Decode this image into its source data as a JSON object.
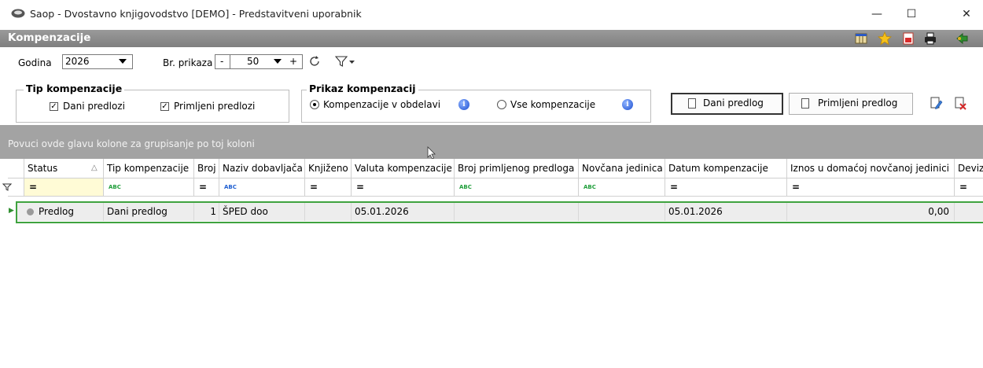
{
  "window": {
    "title": "Saop - Dvostavno knjigovodstvo [DEMO] - Predstavitveni uporabnik",
    "minimize": "—",
    "maximize": "☐",
    "close": "✕"
  },
  "header": {
    "title": "Kompenzacije"
  },
  "toolbar": {
    "year_label": "Godina",
    "year_value": "2026",
    "count_label": "Br. prikaza",
    "count_minus": "-",
    "count_value": "50",
    "count_plus": "+"
  },
  "tip_group": {
    "title": "Tip kompenzacije",
    "given_label": "Dani predlozi",
    "received_label": "Primljeni predlozi"
  },
  "prikaz_group": {
    "title": "Prikaz kompenzacij",
    "option_1": "Kompenzacije v obdelavi",
    "option_2": "Vse kompenzacije"
  },
  "buttons": {
    "dani": "Dani predlog",
    "primljeni": "Primljeni predlog"
  },
  "group_panel_text": "Povuci ovde glavu kolone za grupisanje po toj koloni",
  "columns": [
    "Status",
    "Tip kompenzacije",
    "Broj",
    "Naziv dobavljača",
    "Knjiženo",
    "Valuta kompenzacije",
    "Broj primljenog predloga",
    "Novčana jedinica",
    "Datum kompenzacije",
    "Iznos u domaćoj novčanoj jedinici",
    "Deviz"
  ],
  "filter": {
    "eq": "=",
    "abc": "ABC"
  },
  "rows": [
    {
      "status": "Predlog",
      "tip": "Dani predlog",
      "broj": "1",
      "naziv": "ŠPED doo",
      "knjizeno": "",
      "valuta": "05.01.2026",
      "broj_primljenog": "",
      "novcana": "",
      "datum": "05.01.2026",
      "iznos": "0,00"
    }
  ],
  "colors": {
    "header_bar": "#8c8c8c",
    "group_panel": "#a3a3a3",
    "row_highlight_border": "#3fa33f",
    "filter_abc_green": "#1f9e3a",
    "filter_abc_blue": "#1f5fd1"
  }
}
